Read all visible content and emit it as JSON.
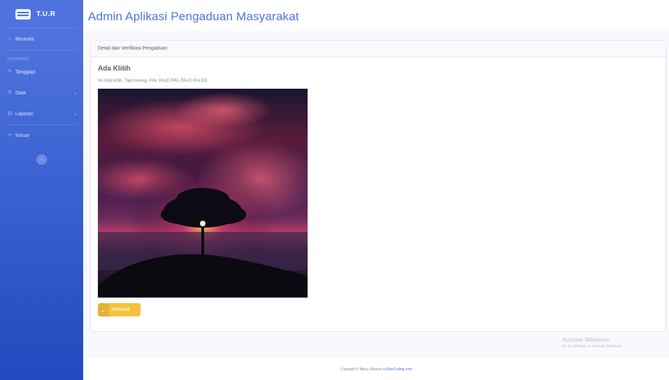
{
  "brand": {
    "text": "T.U.R",
    "icon": "keyboard-icon"
  },
  "sidebar": {
    "items": [
      {
        "label": "Beranda",
        "icon": "home-icon"
      }
    ],
    "section_heading": "INTERFACE",
    "interface_items": [
      {
        "label": "Tanggapi",
        "icon": "edit-icon"
      },
      {
        "label": "Data",
        "icon": "cog-icon"
      },
      {
        "label": "Laporan",
        "icon": "file-icon"
      }
    ],
    "logout": {
      "label": "Keluar",
      "icon": "sign-out-icon"
    }
  },
  "header": {
    "title": "Admin Aplikasi Pengaduan Masyarakat"
  },
  "card": {
    "header": "Detail dan Verifikasi Pengaduan",
    "title": "Ada Klitih",
    "description": "Ini Ada klitih, Tapi boong, PAL PALE PAL PALE PALEE",
    "back_button": "Kembali"
  },
  "watermark": {
    "title": "Activate Windows",
    "subtitle": "Go to Settings to activate Windows."
  },
  "footer": {
    "text": "Copyright © Njing | Repost by ",
    "link": "StokCoding.com"
  },
  "colors": {
    "primary": "#4e73df",
    "warning": "#f6c23e"
  }
}
